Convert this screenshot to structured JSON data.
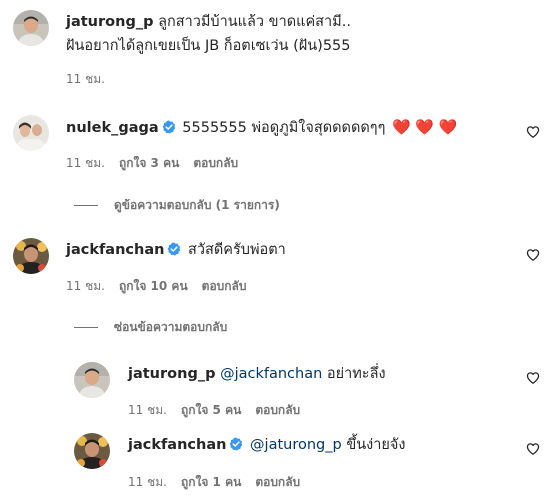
{
  "comments": [
    {
      "username": "jaturong_p",
      "verified": false,
      "mention": "",
      "text_line1": "ลูกสาวมีบ้านแล้ว ขาดแค่สามี..",
      "text_line2": "ฝันอยากได้ลูกเขยเป็น JB ก็อตเซเว่น (ฝัน)555",
      "time": "11 ชม.",
      "likes": "",
      "reply": ""
    },
    {
      "username": "nulek_gaga",
      "verified": true,
      "text": "5555555 พ่อดูภูมิใจสุดดดดดๆๆ",
      "hearts": "❤️ ❤️ ❤️",
      "time": "11 ชม.",
      "likes": "ถูกใจ 3 คน",
      "reply": "ตอบกลับ",
      "replies_toggle": "ดูข้อความตอบกลับ (1 รายการ)"
    },
    {
      "username": "jackfanchan",
      "verified": true,
      "text": "สวัสดีครับพ่อตา",
      "time": "11 ชม.",
      "likes": "ถูกใจ 10 คน",
      "reply": "ตอบกลับ",
      "replies_toggle": "ซ่อนข้อความตอบกลับ"
    }
  ],
  "replies": [
    {
      "username": "jaturong_p",
      "verified": false,
      "mention": "@jackfanchan",
      "text": "อย่าทะลึ่ง",
      "time": "11 ชม.",
      "likes": "ถูกใจ 5 คน",
      "reply": "ตอบกลับ"
    },
    {
      "username": "jackfanchan",
      "verified": true,
      "mention": "@jaturong_p",
      "text": "ขึ้นง่ายจัง",
      "time": "11 ชม.",
      "likes": "ถูกใจ 1 คน",
      "reply": "ตอบกลับ"
    }
  ],
  "colors": {
    "verified_badge": "#3897f0",
    "meta_text": "#737373",
    "mention": "#00376b",
    "heart": "#ed1c3c"
  }
}
